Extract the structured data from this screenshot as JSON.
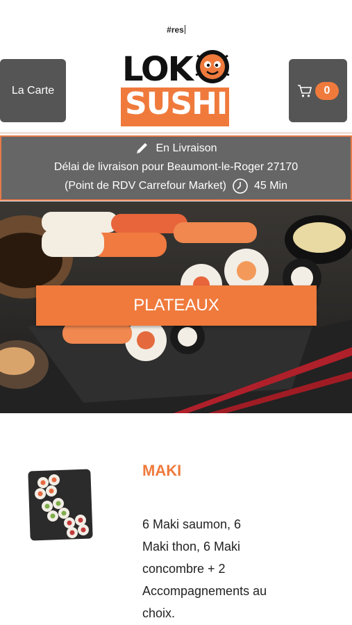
{
  "header": {
    "top_text": "#res",
    "carte_label": "La Carte",
    "cart_count": "0",
    "logo_line1": "LOK",
    "logo_line2": "SUSHI"
  },
  "delivery": {
    "mode": "En Livraison",
    "line2": "Délai de livraison pour Beaumont-le-Roger 27170",
    "line3": "(Point de RDV Carrefour Market)",
    "time": "45 Min"
  },
  "category": {
    "button_label": "PLATEAUX"
  },
  "product": {
    "title": "MAKI",
    "description": "6 Maki saumon,  6 Maki thon,  6 Maki concombre  + 2 Accompagnements au choix."
  },
  "colors": {
    "accent": "#ef7a3c",
    "button_dark": "#555555",
    "info_bg": "#666666"
  },
  "icons": [
    "cart-icon",
    "pencil-icon",
    "clock-icon"
  ]
}
